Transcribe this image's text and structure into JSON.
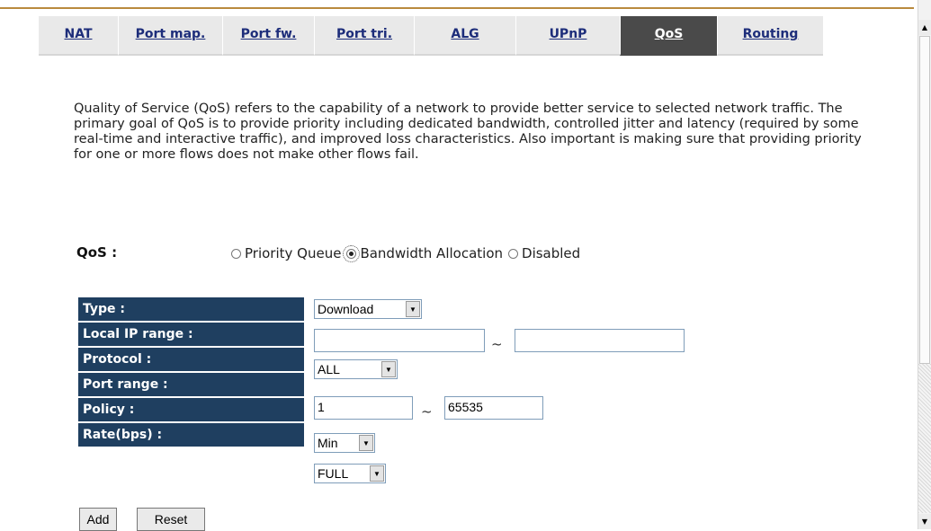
{
  "tabs": [
    {
      "label": "NAT",
      "active": false
    },
    {
      "label": "Port map.",
      "active": false
    },
    {
      "label": "Port fw.",
      "active": false
    },
    {
      "label": "Port tri.",
      "active": false
    },
    {
      "label": "ALG",
      "active": false
    },
    {
      "label": "UPnP",
      "active": false
    },
    {
      "label": "QoS",
      "active": true
    },
    {
      "label": "Routing",
      "active": false
    }
  ],
  "description": "Quality of Service (QoS) refers to the capability of a network to provide better service to selected network traffic. The primary goal of QoS is to provide priority including dedicated bandwidth, controlled jitter and latency (required by some real-time and interactive traffic), and improved loss characteristics. Also important is making sure that providing priority for one or more flows does not make other flows fail.",
  "qos": {
    "label": "QoS :",
    "options": [
      "Priority Queue",
      "Bandwidth Allocation",
      "Disabled"
    ],
    "selected": "Bandwidth Allocation"
  },
  "form": {
    "type_label": "Type :",
    "type_value": "Download",
    "local_ip_label": "Local IP range :",
    "local_ip_start": "",
    "local_ip_end": "",
    "protocol_label": "Protocol :",
    "protocol_value": "ALL",
    "port_range_label": "Port range :",
    "port_start": "1",
    "port_end": "65535",
    "policy_label": "Policy :",
    "policy_value": "Min",
    "rate_label": "Rate(bps) :",
    "rate_value": "FULL",
    "range_separator": "~"
  },
  "buttons": {
    "add": "Add",
    "reset": "Reset"
  },
  "colors": {
    "label_bg": "#1f3f60",
    "tab_active_bg": "#4a4a4a",
    "tab_link": "#1d2d7a",
    "accent_rule": "#b98a3e"
  }
}
